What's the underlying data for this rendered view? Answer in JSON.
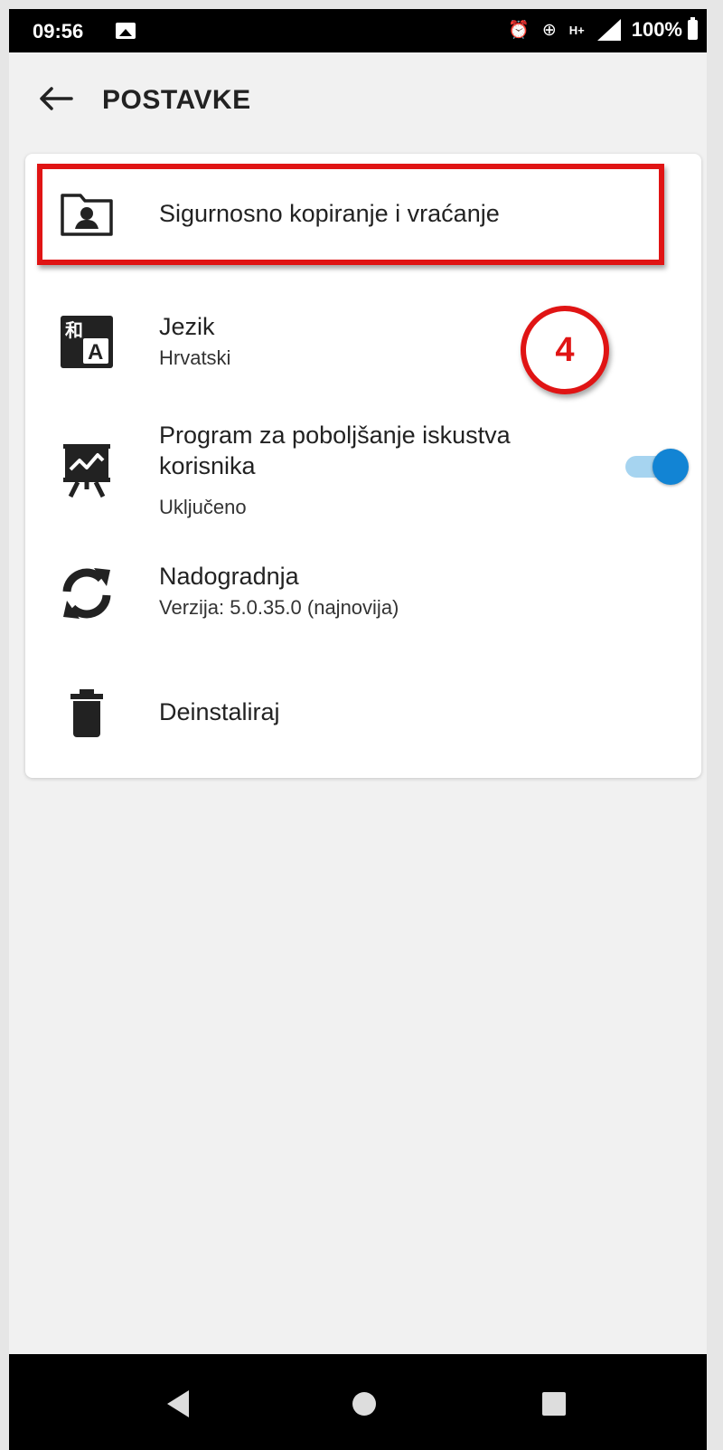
{
  "status_bar": {
    "time": "09:56",
    "battery": "100%",
    "icons": [
      "image-icon",
      "alarm-icon",
      "data-saver-icon",
      "h-plus-network-icon",
      "signal-icon",
      "battery-icon"
    ]
  },
  "app_bar": {
    "title": "POSTAVKE",
    "back_icon": "arrow-back-icon"
  },
  "settings": {
    "items": [
      {
        "icon": "folder-account-icon",
        "title": "Sigurnosno kopiranje i vraćanje"
      },
      {
        "icon": "translate-icon",
        "title": "Jezik",
        "subtitle": "Hrvatski"
      },
      {
        "icon": "presentation-chart-icon",
        "title_line1": "Program za poboljšanje iskustva",
        "title_line2": "korisnika",
        "subtitle": "Uključeno",
        "toggle_on": true
      },
      {
        "icon": "sync-icon",
        "title": "Nadogradnja",
        "subtitle": "Verzija: 5.0.35.0 (najnovija)"
      },
      {
        "icon": "trash-icon",
        "title": "Deinstaliraj"
      }
    ]
  },
  "annotation": {
    "step_number": "4",
    "color": "#e01414"
  },
  "nav_bar": {
    "buttons": [
      "back-triangle-icon",
      "home-circle-icon",
      "recents-square-icon"
    ]
  },
  "colors": {
    "toggle_thumb": "#1284d4",
    "toggle_track": "#a6d4f0",
    "icon": "#222222"
  }
}
